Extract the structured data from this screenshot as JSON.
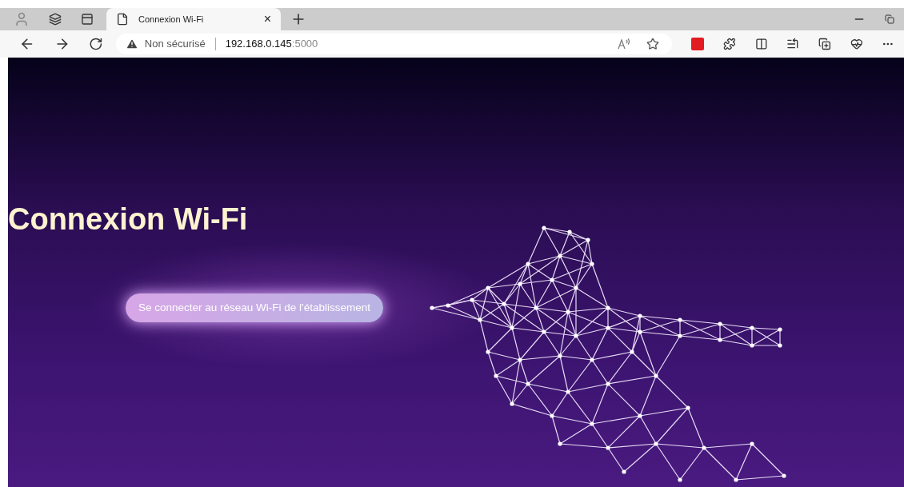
{
  "browser": {
    "tab": {
      "title": "Connexion Wi-Fi",
      "close": "×"
    },
    "address": {
      "security": "Non sécurisé",
      "host": "192.168.0.145",
      "port": ":5000"
    }
  },
  "page": {
    "title": "Connexion Wi-Fi",
    "button": "Se connecter au réseau Wi-Fi de l'établissement"
  }
}
